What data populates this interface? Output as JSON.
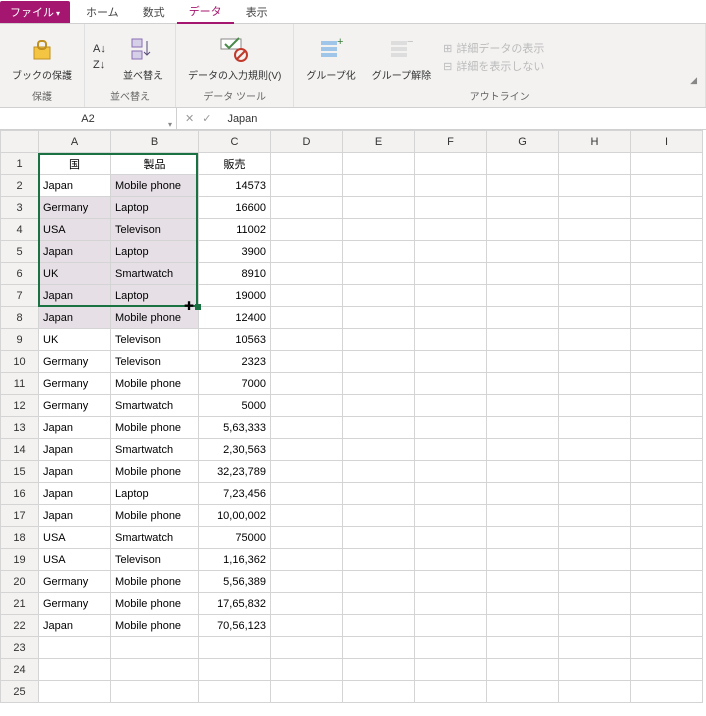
{
  "tabs": {
    "file": "ファイル",
    "home": "ホーム",
    "formulas": "数式",
    "data": "データ",
    "view": "表示"
  },
  "ribbon": {
    "protect": {
      "btn": "ブックの保護",
      "label": "保護"
    },
    "sort": {
      "btn": "並べ替え",
      "label": "並べ替え"
    },
    "datatools": {
      "btn": "データの入力規則(V)",
      "label": "データ ツール"
    },
    "outline": {
      "group": "グループ化",
      "ungroup": "グループ解除",
      "showdetail": "詳細データの表示",
      "hidedetail": "詳細を表示しない",
      "label": "アウトライン"
    }
  },
  "namebox": "A2",
  "formula": "Japan",
  "columns": [
    "A",
    "B",
    "C",
    "D",
    "E",
    "F",
    "G",
    "H",
    "I"
  ],
  "rowcount": 25,
  "headers": {
    "a": "国",
    "b": "製品",
    "c": "販売"
  },
  "rows": [
    {
      "a": "Japan",
      "b": "Mobile phone",
      "c": "14573"
    },
    {
      "a": "Germany",
      "b": "Laptop",
      "c": "16600"
    },
    {
      "a": "USA",
      "b": "Televison",
      "c": "11002"
    },
    {
      "a": "Japan",
      "b": "Laptop",
      "c": "3900"
    },
    {
      "a": "UK",
      "b": "Smartwatch",
      "c": "8910"
    },
    {
      "a": "Japan",
      "b": "Laptop",
      "c": "19000"
    },
    {
      "a": "Japan",
      "b": "Mobile phone",
      "c": "12400"
    },
    {
      "a": "UK",
      "b": "Televison",
      "c": "10563"
    },
    {
      "a": "Germany",
      "b": "Televison",
      "c": "2323"
    },
    {
      "a": "Germany",
      "b": "Mobile phone",
      "c": "7000"
    },
    {
      "a": "Germany",
      "b": "Smartwatch",
      "c": "5000"
    },
    {
      "a": "Japan",
      "b": "Mobile phone",
      "c": "5,63,333"
    },
    {
      "a": "Japan",
      "b": "Smartwatch",
      "c": "2,30,563"
    },
    {
      "a": "Japan",
      "b": "Mobile phone",
      "c": "32,23,789"
    },
    {
      "a": "Japan",
      "b": "Laptop",
      "c": "7,23,456"
    },
    {
      "a": "Japan",
      "b": "Mobile phone",
      "c": "10,00,002"
    },
    {
      "a": "USA",
      "b": "Smartwatch",
      "c": "75000"
    },
    {
      "a": "USA",
      "b": "Televison",
      "c": "1,16,362"
    },
    {
      "a": "Germany",
      "b": "Mobile phone",
      "c": "5,56,389"
    },
    {
      "a": "Germany",
      "b": "Mobile phone",
      "c": "17,65,832"
    },
    {
      "a": "Japan",
      "b": "Mobile phone",
      "c": "70,56,123"
    }
  ]
}
